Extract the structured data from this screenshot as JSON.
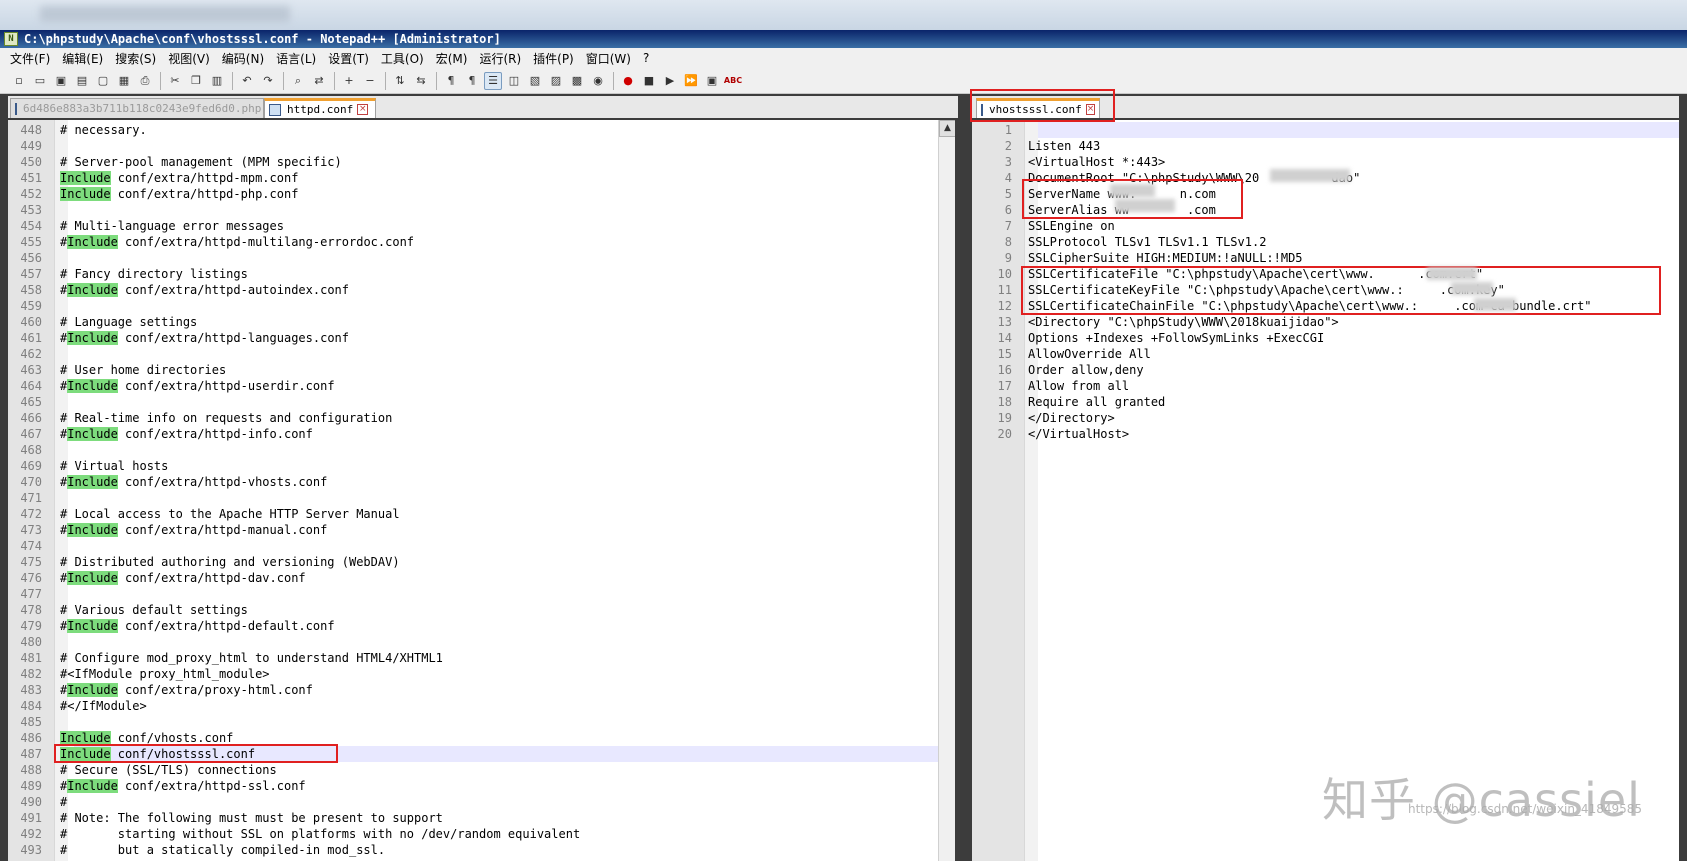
{
  "window": {
    "title": "C:\\phpstudy\\Apache\\conf\\vhostsssl.conf - Notepad++ [Administrator]"
  },
  "menu": [
    "文件(F)",
    "编辑(E)",
    "搜索(S)",
    "视图(V)",
    "编码(N)",
    "语言(L)",
    "设置(T)",
    "工具(O)",
    "宏(M)",
    "运行(R)",
    "插件(P)",
    "窗口(W)",
    "?"
  ],
  "toolbar": {
    "icons": [
      "new-file-icon",
      "open-file-icon",
      "save-icon",
      "save-all-icon",
      "close-icon",
      "close-all-icon",
      "print-icon",
      "cut-icon",
      "copy-icon",
      "paste-icon",
      "undo-icon",
      "redo-icon",
      "find-icon",
      "replace-icon",
      "zoom-in-icon",
      "zoom-out-icon",
      "sync-v-icon",
      "sync-h-icon",
      "word-wrap-icon",
      "show-all-chars-icon",
      "indent-guide-icon",
      "udl-icon",
      "doc-map-icon",
      "function-list-icon",
      "folder-workspace-icon",
      "monitor-icon",
      "record-macro-icon",
      "stop-macro-icon",
      "play-macro-icon",
      "run-macro-multiple-icon",
      "save-macro-icon",
      "spellcheck-icon"
    ],
    "spellcheck_label": "ABC"
  },
  "tabs_left": [
    {
      "label": "6d486e883a3b711b118c0243e9fed6d0.php",
      "active": false
    },
    {
      "label": "httpd.conf",
      "active": true
    }
  ],
  "tabs_right": [
    {
      "label": "vhostsssl.conf",
      "active": true
    }
  ],
  "left_editor": {
    "keyword": "Include",
    "lines": [
      {
        "n": "448",
        "pre": "# necessary.",
        "kw": false,
        "post": ""
      },
      {
        "n": "449",
        "pre": "",
        "kw": false,
        "post": ""
      },
      {
        "n": "450",
        "pre": "# Server-pool management (MPM specific)",
        "kw": false,
        "post": ""
      },
      {
        "n": "451",
        "pre": "",
        "kw": true,
        "post": " conf/extra/httpd-mpm.conf"
      },
      {
        "n": "452",
        "pre": "",
        "kw": true,
        "post": " conf/extra/httpd-php.conf"
      },
      {
        "n": "453",
        "pre": "",
        "kw": false,
        "post": ""
      },
      {
        "n": "454",
        "pre": "# Multi-language error messages",
        "kw": false,
        "post": ""
      },
      {
        "n": "455",
        "pre": "#",
        "kw": true,
        "post": " conf/extra/httpd-multilang-errordoc.conf"
      },
      {
        "n": "456",
        "pre": "",
        "kw": false,
        "post": ""
      },
      {
        "n": "457",
        "pre": "# Fancy directory listings",
        "kw": false,
        "post": ""
      },
      {
        "n": "458",
        "pre": "#",
        "kw": true,
        "post": " conf/extra/httpd-autoindex.conf"
      },
      {
        "n": "459",
        "pre": "",
        "kw": false,
        "post": ""
      },
      {
        "n": "460",
        "pre": "# Language settings",
        "kw": false,
        "post": ""
      },
      {
        "n": "461",
        "pre": "#",
        "kw": true,
        "post": " conf/extra/httpd-languages.conf"
      },
      {
        "n": "462",
        "pre": "",
        "kw": false,
        "post": ""
      },
      {
        "n": "463",
        "pre": "# User home directories",
        "kw": false,
        "post": ""
      },
      {
        "n": "464",
        "pre": "#",
        "kw": true,
        "post": " conf/extra/httpd-userdir.conf"
      },
      {
        "n": "465",
        "pre": "",
        "kw": false,
        "post": ""
      },
      {
        "n": "466",
        "pre": "# Real-time info on requests and configuration",
        "kw": false,
        "post": ""
      },
      {
        "n": "467",
        "pre": "#",
        "kw": true,
        "post": " conf/extra/httpd-info.conf"
      },
      {
        "n": "468",
        "pre": "",
        "kw": false,
        "post": ""
      },
      {
        "n": "469",
        "pre": "# Virtual hosts",
        "kw": false,
        "post": ""
      },
      {
        "n": "470",
        "pre": "#",
        "kw": true,
        "post": " conf/extra/httpd-vhosts.conf"
      },
      {
        "n": "471",
        "pre": "",
        "kw": false,
        "post": ""
      },
      {
        "n": "472",
        "pre": "# Local access to the Apache HTTP Server Manual",
        "kw": false,
        "post": ""
      },
      {
        "n": "473",
        "pre": "#",
        "kw": true,
        "post": " conf/extra/httpd-manual.conf"
      },
      {
        "n": "474",
        "pre": "",
        "kw": false,
        "post": ""
      },
      {
        "n": "475",
        "pre": "# Distributed authoring and versioning (WebDAV)",
        "kw": false,
        "post": ""
      },
      {
        "n": "476",
        "pre": "#",
        "kw": true,
        "post": " conf/extra/httpd-dav.conf"
      },
      {
        "n": "477",
        "pre": "",
        "kw": false,
        "post": ""
      },
      {
        "n": "478",
        "pre": "# Various default settings",
        "kw": false,
        "post": ""
      },
      {
        "n": "479",
        "pre": "#",
        "kw": true,
        "post": " conf/extra/httpd-default.conf"
      },
      {
        "n": "480",
        "pre": "",
        "kw": false,
        "post": ""
      },
      {
        "n": "481",
        "pre": "# Configure mod_proxy_html to understand HTML4/XHTML1",
        "kw": false,
        "post": ""
      },
      {
        "n": "482",
        "pre": "#<IfModule proxy_html_module>",
        "kw": false,
        "post": ""
      },
      {
        "n": "483",
        "pre": "#",
        "kw": true,
        "post": " conf/extra/proxy-html.conf"
      },
      {
        "n": "484",
        "pre": "#</IfModule>",
        "kw": false,
        "post": ""
      },
      {
        "n": "485",
        "pre": "",
        "kw": false,
        "post": ""
      },
      {
        "n": "486",
        "pre": "",
        "kw": true,
        "post": " conf/vhosts.conf"
      },
      {
        "n": "487",
        "pre": "",
        "kw": true,
        "post": " conf/vhostsssl.conf"
      },
      {
        "n": "488",
        "pre": "# Secure (SSL/TLS) connections",
        "kw": false,
        "post": ""
      },
      {
        "n": "489",
        "pre": "#",
        "kw": true,
        "post": " conf/extra/httpd-ssl.conf"
      },
      {
        "n": "490",
        "pre": "#",
        "kw": false,
        "post": ""
      },
      {
        "n": "491",
        "pre": "# Note: The following must must be present to support",
        "kw": false,
        "post": ""
      },
      {
        "n": "492",
        "pre": "#       starting without SSL on platforms with no /dev/random equivalent",
        "kw": false,
        "post": ""
      },
      {
        "n": "493",
        "pre": "#       but a statically compiled-in mod_ssl.",
        "kw": false,
        "post": ""
      }
    ]
  },
  "right_editor": {
    "lines": [
      {
        "n": "1",
        "text": ""
      },
      {
        "n": "2",
        "text": "Listen 443"
      },
      {
        "n": "3",
        "text": "<VirtualHost *:443>"
      },
      {
        "n": "4",
        "text": "DocumentRoot \"C:\\phpStudy\\WWW\\20          dao\""
      },
      {
        "n": "5",
        "text": "ServerName www.      n.com"
      },
      {
        "n": "6",
        "text": "ServerAlias ww        .com"
      },
      {
        "n": "7",
        "text": "SSLEngine on"
      },
      {
        "n": "8",
        "text": "SSLProtocol TLSv1 TLSv1.1 TLSv1.2"
      },
      {
        "n": "9",
        "text": "SSLCipherSuite HIGH:MEDIUM:!aNULL:!MD5"
      },
      {
        "n": "10",
        "text": "SSLCertificateFile \"C:\\phpstudy\\Apache\\cert\\www.      .com.crt\""
      },
      {
        "n": "11",
        "text": "SSLCertificateKeyFile \"C:\\phpstudy\\Apache\\cert\\www.:     .com.key\""
      },
      {
        "n": "12",
        "text": "SSLCertificateChainFile \"C:\\phpstudy\\Apache\\cert\\www.:     .com-ca-bundle.crt\""
      },
      {
        "n": "13",
        "text": "<Directory \"C:\\phpStudy\\WWW\\2018kuaijidao\">"
      },
      {
        "n": "14",
        "text": "Options +Indexes +FollowSymLinks +ExecCGI"
      },
      {
        "n": "15",
        "text": "AllowOverride All"
      },
      {
        "n": "16",
        "text": "Order allow,deny"
      },
      {
        "n": "17",
        "text": "Allow from all"
      },
      {
        "n": "18",
        "text": "Require all granted"
      },
      {
        "n": "19",
        "text": "</Directory>"
      },
      {
        "n": "20",
        "text": "</VirtualHost>"
      }
    ]
  },
  "watermark": {
    "text": "知乎 @cassiel",
    "url": "https://blog.csdn.net/weixin_41849585"
  },
  "colors": {
    "keyword_highlight": "#7ddc7d",
    "annotation_box": "#e02020",
    "active_tab_accent": "#f0a030"
  }
}
